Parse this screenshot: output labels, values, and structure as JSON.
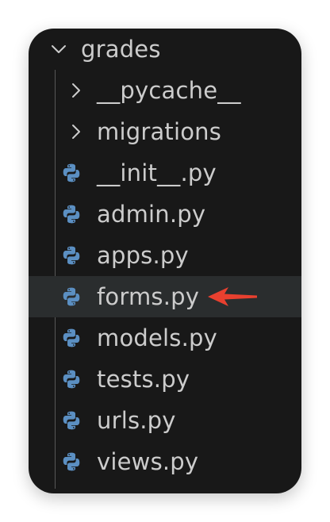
{
  "explorer": {
    "root_folder": {
      "name": "grades",
      "expanded": true,
      "icon": "chevron-down-icon"
    },
    "children": [
      {
        "name": "__pycache__",
        "kind": "folder",
        "icon": "chevron-right-icon"
      },
      {
        "name": "migrations",
        "kind": "folder",
        "icon": "chevron-right-icon"
      },
      {
        "name": "__init__.py",
        "kind": "file",
        "icon": "python-file-icon"
      },
      {
        "name": "admin.py",
        "kind": "file",
        "icon": "python-file-icon"
      },
      {
        "name": "apps.py",
        "kind": "file",
        "icon": "python-file-icon"
      },
      {
        "name": "forms.py",
        "kind": "file",
        "icon": "python-file-icon",
        "selected": true
      },
      {
        "name": "models.py",
        "kind": "file",
        "icon": "python-file-icon"
      },
      {
        "name": "tests.py",
        "kind": "file",
        "icon": "python-file-icon"
      },
      {
        "name": "urls.py",
        "kind": "file",
        "icon": "python-file-icon"
      },
      {
        "name": "views.py",
        "kind": "file",
        "icon": "python-file-icon"
      }
    ]
  },
  "annotation": {
    "icon": "red-arrow-left-icon",
    "color": "#e8402f"
  },
  "colors": {
    "panel_background": "#181818",
    "selected_row": "#2a2d2e",
    "text": "#cccccc",
    "python_icon": "#5b8fc2"
  }
}
